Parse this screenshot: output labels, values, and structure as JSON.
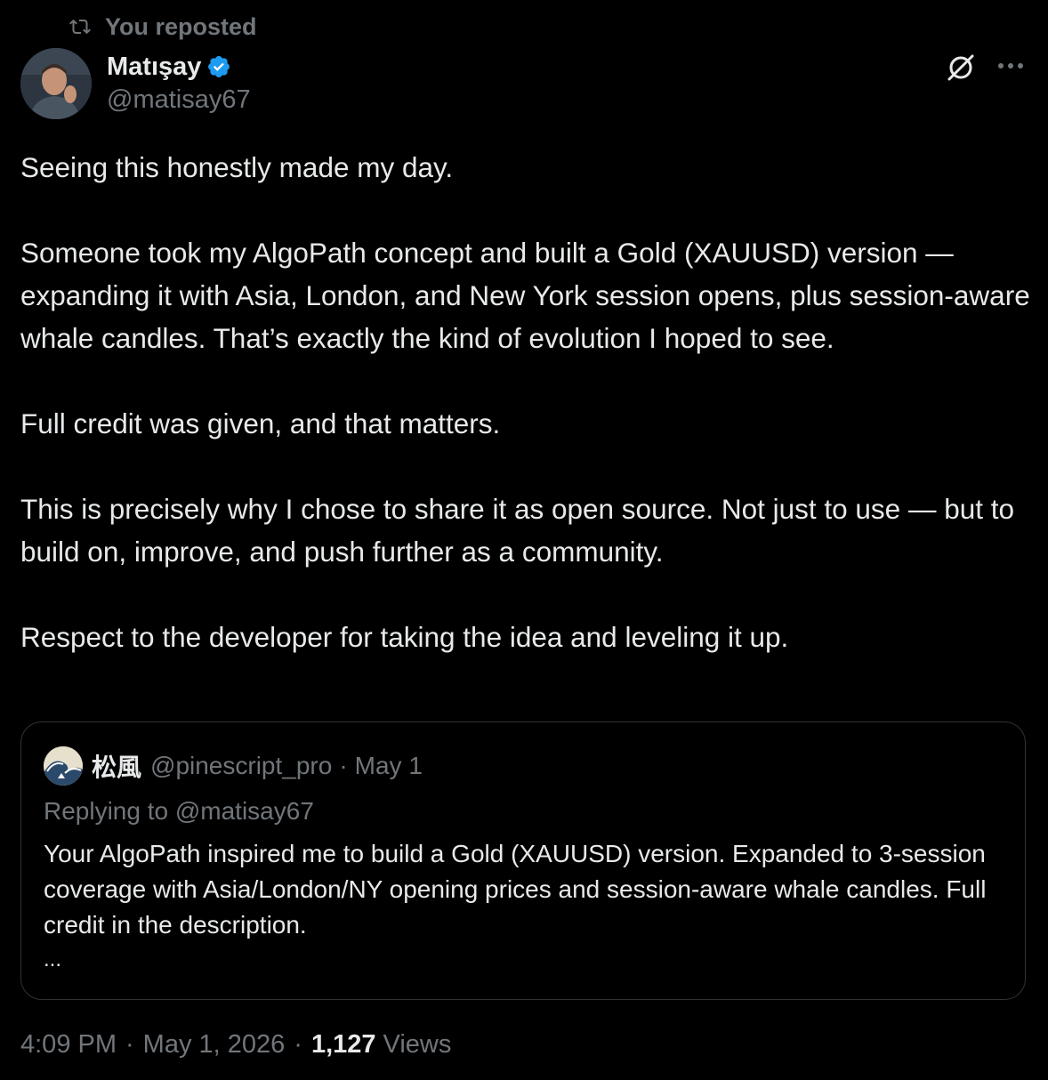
{
  "repost": {
    "label": "You reposted",
    "icon": "repost-icon"
  },
  "author": {
    "name": "Matışay",
    "handle": "@matisay67",
    "verified": true,
    "verified_color": "#1d9bf0"
  },
  "actions": {
    "grok_icon": "grok-icon",
    "more_icon": "more-icon"
  },
  "tweet": {
    "paragraphs": [
      "Seeing this honestly made my day.",
      "Someone took my AlgoPath concept and built a Gold (XAUUSD) version — expanding it with Asia, London, and New York session opens, plus session-aware whale candles. That’s exactly the kind of evolution I hoped to see.",
      "Full credit was given, and that matters.",
      "This is precisely why I chose to share it as open source. Not just to use — but to build on, improve, and push further as a community.",
      "Respect to the developer for taking the idea and leveling it up."
    ]
  },
  "quote": {
    "name": "松風",
    "handle": "@pinescript_pro",
    "separator": "·",
    "date": "May 1",
    "replying_to": "Replying to @matisay67",
    "text": "Your AlgoPath inspired me to build a Gold (XAUUSD) version. Expanded to 3-session coverage with Asia/London/NY opening prices and session-aware whale candles. Full credit in the description.",
    "more": "..."
  },
  "meta": {
    "time": "4:09 PM",
    "separator": "·",
    "date": "May 1, 2026",
    "views_count": "1,127",
    "views_label": "Views"
  },
  "colors": {
    "background": "#000000",
    "text_primary": "#e7e9ea",
    "text_secondary": "#71767b",
    "border": "#2f3336",
    "accent": "#1d9bf0"
  }
}
